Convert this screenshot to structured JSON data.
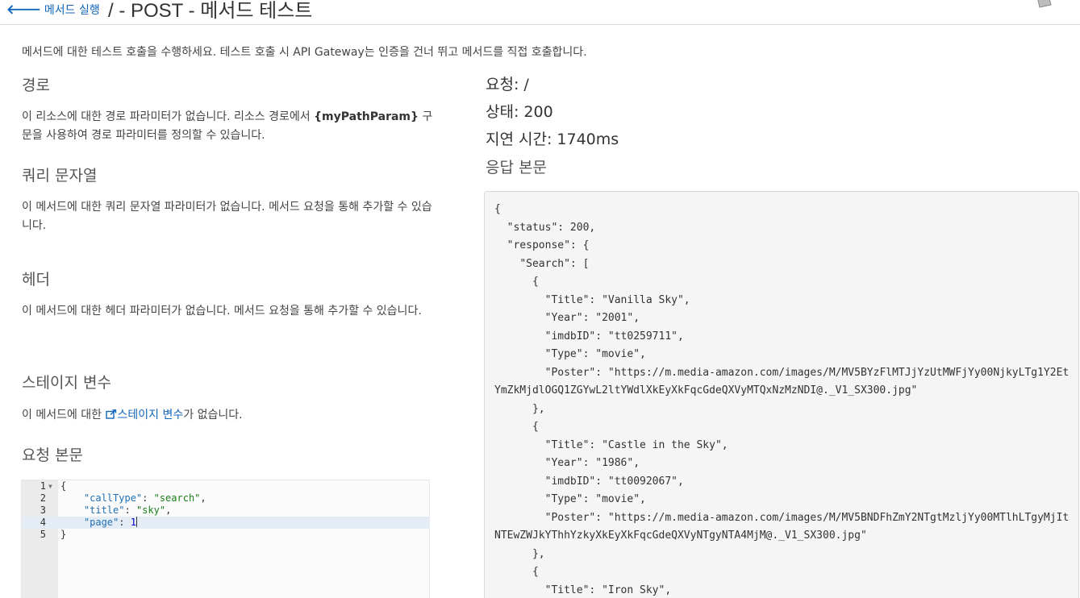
{
  "header": {
    "back_label": "메서드 실행",
    "title": "/ - POST - 메서드 테스트"
  },
  "intro": "메서드에 대한 테스트 호출을 수행하세요. 테스트 호출 시 API Gateway는 인증을 건너 뛰고 메서드를 직접 호출합니다.",
  "sections": {
    "path": {
      "heading": "경로",
      "text_before": "이 리소스에 대한 경로 파라미터가 없습니다. 리소스 경로에서 ",
      "param": "{myPathParam}",
      "text_after": " 구문을 사용하여 경로 파라미터를 정의할 수 있습니다."
    },
    "query": {
      "heading": "쿼리 문자열",
      "text": "이 메서드에 대한 쿼리 문자열 파라미터가 없습니다. 메서드 요청을 통해 추가할 수 있습니다."
    },
    "headers": {
      "heading": "헤더",
      "text": "이 메서드에 대한 헤더 파라미터가 없습니다. 메서드 요청을 통해 추가할 수 있습니다."
    },
    "stage": {
      "heading": "스테이지 변수",
      "text_before": "이 메서드에 대한 ",
      "link": "스테이지 변수",
      "text_after": "가 없습니다."
    },
    "body": {
      "heading": "요청 본문"
    }
  },
  "editor": {
    "lines": [
      {
        "num": "1",
        "code": "{"
      },
      {
        "num": "2",
        "key": "\"callType\"",
        "value": "\"search\"",
        "trail": ","
      },
      {
        "num": "3",
        "key": "\"title\"",
        "value": "\"sky\"",
        "trail": ","
      },
      {
        "num": "4",
        "key": "\"page\"",
        "value": "1",
        "trail": ""
      },
      {
        "num": "5",
        "code": "}"
      }
    ]
  },
  "result": {
    "request": "요청: /",
    "status": "상태: 200",
    "latency": "지연 시간: 1740ms",
    "body_heading": "응답 본문",
    "body": "{\n  \"status\": 200,\n  \"response\": {\n    \"Search\": [\n      {\n        \"Title\": \"Vanilla Sky\",\n        \"Year\": \"2001\",\n        \"imdbID\": \"tt0259711\",\n        \"Type\": \"movie\",\n        \"Poster\": \"https://m.media-amazon.com/images/M/MV5BYzFlMTJjYzUtMWFjYy00NjkyLTg1Y2EtYmZkMjdlOGQ1ZGYwL2ltYWdlXkEyXkFqcGdeQXVyMTQxNzMzNDI@._V1_SX300.jpg\"\n      },\n      {\n        \"Title\": \"Castle in the Sky\",\n        \"Year\": \"1986\",\n        \"imdbID\": \"tt0092067\",\n        \"Type\": \"movie\",\n        \"Poster\": \"https://m.media-amazon.com/images/M/MV5BNDFhZmY2NTgtMzljYy00MTlhLTgyMjItNTEwZWJkYThhYzkyXkEyXkFqcGdeQXVyNTgyNTA4MjM@._V1_SX300.jpg\"\n      },\n      {\n        \"Title\": \"Iron Sky\","
  }
}
